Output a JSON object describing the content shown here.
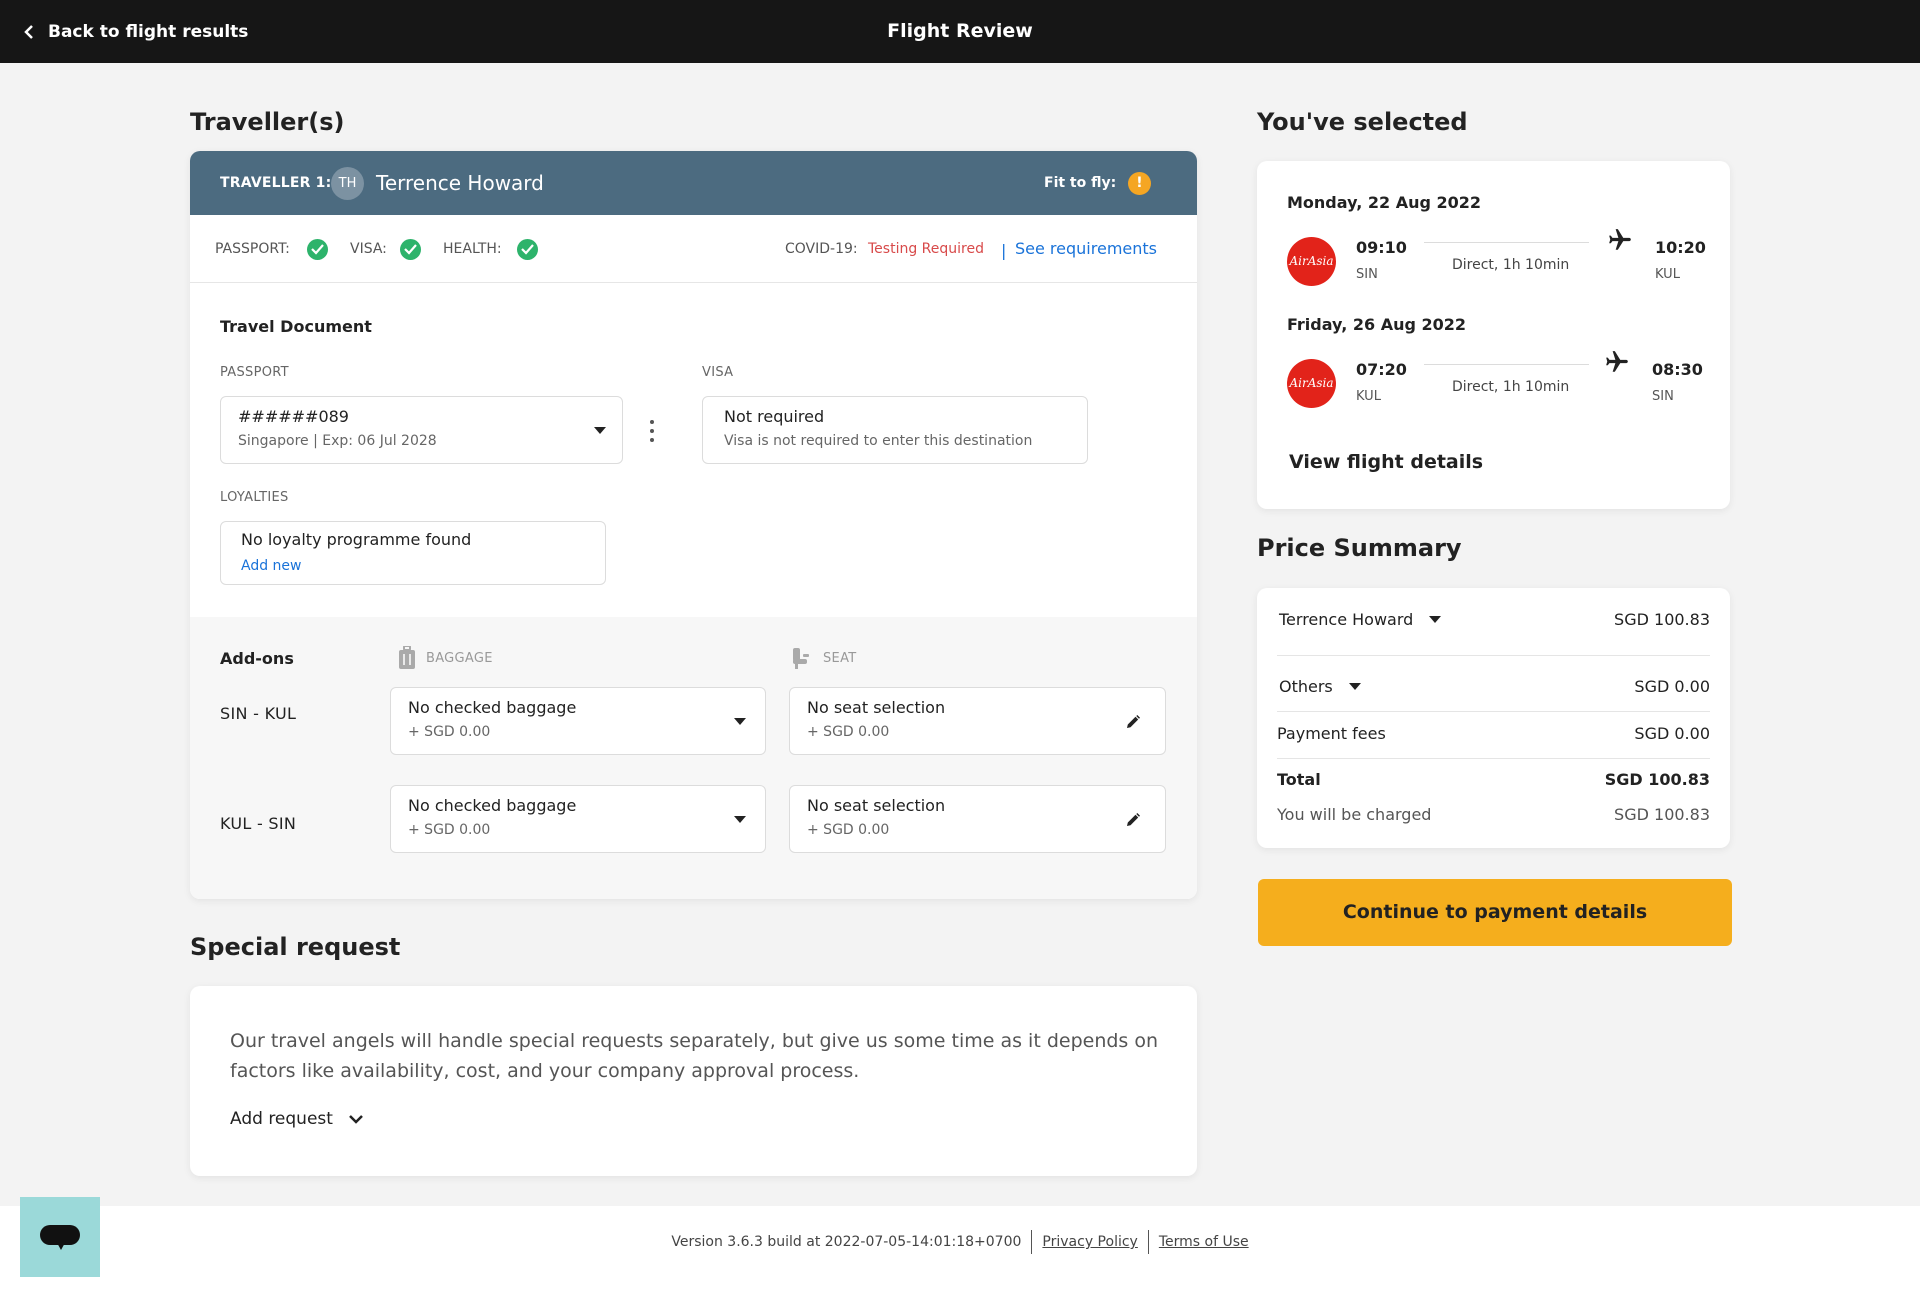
{
  "topbar": {
    "back_label": "Back to flight results",
    "title": "Flight Review"
  },
  "travellers": {
    "heading": "Traveller(s)",
    "traveller_label": "TRAVELLER 1:",
    "initials": "TH",
    "name": "Terrence Howard",
    "fit_to_fly_label": "Fit to fly:",
    "fit_to_fly_icon": "warning-icon",
    "checks": {
      "passport_label": "PASSPORT:",
      "visa_label": "VISA:",
      "health_label": "HEALTH:",
      "covid_label": "COVID-19:",
      "covid_value": "Testing Required",
      "separator": "|",
      "see_requirements": "See requirements"
    },
    "travel_document": {
      "title": "Travel Document",
      "passport_label": "PASSPORT",
      "passport_number": "######089",
      "passport_detail": "Singapore | Exp: 06 Jul 2028",
      "visa_label": "VISA",
      "visa_value": "Not required",
      "visa_detail": "Visa is not required to enter this destination",
      "loyalties_label": "LOYALTIES",
      "loyalty_value": "No loyalty programme found",
      "loyalty_add": "Add new"
    },
    "addons": {
      "title": "Add-ons",
      "baggage_label": "BAGGAGE",
      "seat_label": "SEAT",
      "rows": [
        {
          "route": "SIN - KUL",
          "baggage": "No checked baggage",
          "baggage_price": "+ SGD 0.00",
          "seat": "No seat selection",
          "seat_price": "+ SGD 0.00"
        },
        {
          "route": "KUL - SIN",
          "baggage": "No checked baggage",
          "baggage_price": "+ SGD 0.00",
          "seat": "No seat selection",
          "seat_price": "+ SGD 0.00"
        }
      ]
    }
  },
  "special_request": {
    "heading": "Special request",
    "text": "Our travel angels will handle special requests separately, but give us some time as it depends on factors like availability, cost, and your company approval process.",
    "add_label": "Add request"
  },
  "selected": {
    "heading": "You've selected",
    "flights": [
      {
        "date": "Monday, 22 Aug 2022",
        "airline_logo": "AirAsia",
        "dep_time": "09:10",
        "dep_airport": "SIN",
        "duration": "Direct, 1h 10min",
        "arr_time": "10:20",
        "arr_airport": "KUL"
      },
      {
        "date": "Friday, 26 Aug 2022",
        "airline_logo": "AirAsia",
        "dep_time": "07:20",
        "dep_airport": "KUL",
        "duration": "Direct, 1h 10min",
        "arr_time": "08:30",
        "arr_airport": "SIN"
      }
    ],
    "view_details": "View flight details"
  },
  "price_summary": {
    "heading": "Price Summary",
    "traveller_name": "Terrence Howard",
    "traveller_amount": "SGD 100.83",
    "others_label": "Others",
    "others_amount": "SGD 0.00",
    "payment_fees_label": "Payment fees",
    "payment_fees_amount": "SGD 0.00",
    "total_label": "Total",
    "total_amount": "SGD 100.83",
    "charged_label": "You will be charged",
    "charged_amount": "SGD 100.83"
  },
  "cta_label": "Continue to payment details",
  "footer": {
    "version": "Version 3.6.3 build at 2022-07-05-14:01:18+0700",
    "privacy": "Privacy Policy",
    "terms": "Terms of Use"
  },
  "colors": {
    "topbar": "#161616",
    "traveller_header": "#4c6b80",
    "accent_blue": "#1a73d9",
    "cta": "#f5ae1d",
    "success": "#2db36b",
    "warning": "#f5a623",
    "covid_red": "#d84a4a",
    "airline_red": "#e2231a",
    "chat": "#9bd9d9"
  }
}
